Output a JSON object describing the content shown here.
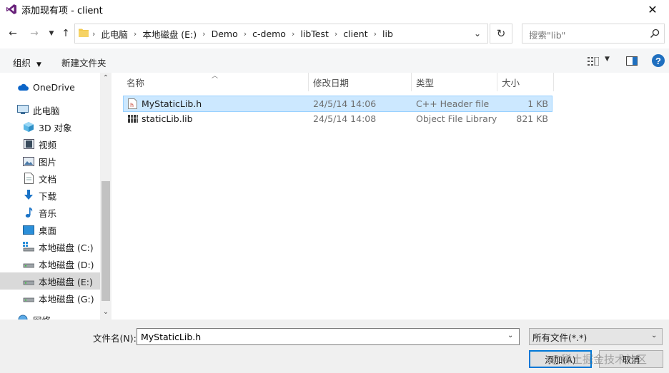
{
  "window": {
    "title": "添加现有项 - client"
  },
  "address": {
    "crumbs": [
      "此电脑",
      "本地磁盘 (E:)",
      "Demo",
      "c-demo",
      "libTest",
      "client",
      "lib"
    ],
    "search_placeholder": "搜索\"lib\""
  },
  "toolbar": {
    "organize_label": "组织",
    "new_folder_label": "新建文件夹"
  },
  "sidebar": {
    "items": [
      {
        "label": "OneDrive",
        "icon": "cloud-icon"
      },
      {
        "label": "此电脑",
        "icon": "computer-icon"
      },
      {
        "label": "3D 对象",
        "icon": "cube-icon"
      },
      {
        "label": "视频",
        "icon": "video-icon"
      },
      {
        "label": "图片",
        "icon": "picture-icon"
      },
      {
        "label": "文档",
        "icon": "document-icon"
      },
      {
        "label": "下载",
        "icon": "download-icon"
      },
      {
        "label": "音乐",
        "icon": "music-icon"
      },
      {
        "label": "桌面",
        "icon": "desktop-icon"
      },
      {
        "label": "本地磁盘 (C:)",
        "icon": "drive-icon"
      },
      {
        "label": "本地磁盘 (D:)",
        "icon": "drive-icon"
      },
      {
        "label": "本地磁盘 (E:)",
        "icon": "drive-icon",
        "selected": true
      },
      {
        "label": "本地磁盘 (G:)",
        "icon": "drive-icon"
      },
      {
        "label": "网络",
        "icon": "network-icon"
      }
    ]
  },
  "columns": {
    "name": "名称",
    "modified": "修改日期",
    "type": "类型",
    "size": "大小"
  },
  "files": [
    {
      "name": "MyStaticLib.h",
      "modified": "24/5/14 14:06",
      "type": "C++ Header file",
      "size": "1 KB",
      "selected": true,
      "icon": "header-file-icon"
    },
    {
      "name": "staticLib.lib",
      "modified": "24/5/14 14:08",
      "type": "Object File Library",
      "size": "821 KB",
      "selected": false,
      "icon": "library-file-icon"
    }
  ],
  "bottom": {
    "filename_label": "文件名(N):",
    "filename_value": "MyStaticLib.h",
    "filetype_value": "所有文件(*.*)",
    "add_label": "添加(A)",
    "cancel_label": "取消"
  },
  "watermark": "@稀土掘金技术社区",
  "colors": {
    "selection": "#cce8ff",
    "accent": "#0078d7",
    "vs_purple": "#68217a"
  }
}
